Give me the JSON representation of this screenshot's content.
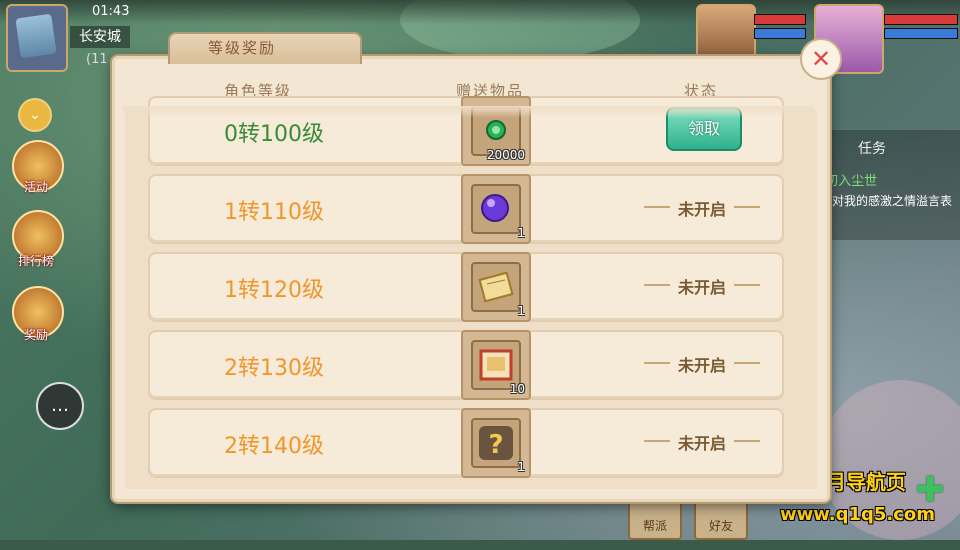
{
  "hud": {
    "clock": "01:43",
    "city": "长安城",
    "city_sub": "(11",
    "side_buttons": [
      "活动",
      "排行榜",
      "奖励"
    ],
    "task_title": "任务",
    "task_line1": "第 初入尘世",
    "task_line2": "大妈对我的感激之情溢言表啊",
    "bottom_buttons": [
      "帮派",
      "好友"
    ],
    "watermark_line1": "踏月导航页",
    "watermark_line2": "www.q1q5.com"
  },
  "dialog": {
    "title": "等级奖励",
    "headers": {
      "level": "角色等级",
      "reward": "赠送物品",
      "status": "状态"
    },
    "rows": [
      {
        "level": "0转100级",
        "qty": "20000",
        "icon": "jade-coin-icon",
        "status": "领取",
        "claimable": true
      },
      {
        "level": "1转110级",
        "qty": "1",
        "icon": "purple-orb-icon",
        "status": "未开启",
        "claimable": false
      },
      {
        "level": "1转120级",
        "qty": "1",
        "icon": "scroll-book-icon",
        "status": "未开启",
        "claimable": false
      },
      {
        "level": "2转130级",
        "qty": "10",
        "icon": "red-book-icon",
        "status": "未开启",
        "claimable": false
      },
      {
        "level": "2转140级",
        "qty": "1",
        "icon": "question-mark-icon",
        "status": "未开启",
        "claimable": false
      }
    ],
    "close_symbol": "✕"
  }
}
